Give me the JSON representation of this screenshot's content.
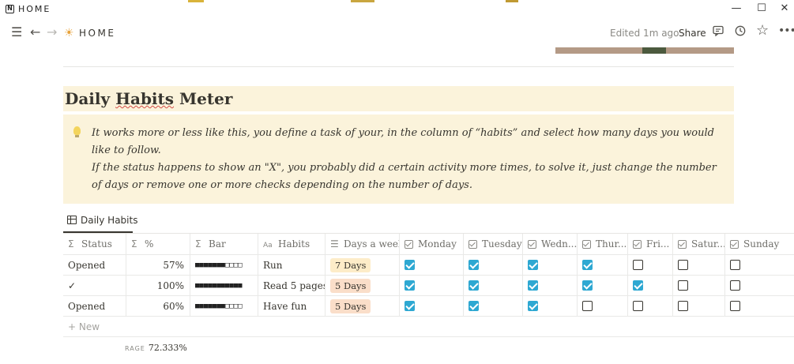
{
  "window": {
    "title": "HOME"
  },
  "toolbar": {
    "page_emoji": "☀",
    "page_title": "HOME",
    "edited": "Edited 1m ago",
    "share": "Share"
  },
  "heading": {
    "word1": "Daily",
    "word2": "Habits",
    "word3": "Meter"
  },
  "callout": {
    "p1": "It works more or less like this, you define a task of your, in the column of “habits” and select how many days you would like to follow.",
    "p2": "If the status happens to show an \"X\", you probably did a certain activity more times, to solve it, just change the number of days or remove one or more checks depending on the number of days."
  },
  "view": {
    "tab": "Daily Habits"
  },
  "columns": [
    "Status",
    "%",
    "Bar",
    "Habits",
    "Days a week",
    "Monday",
    "Tuesday",
    "Wedn...",
    "Thur...",
    "Fri...",
    "Satur...",
    "Sunday"
  ],
  "rows": [
    {
      "status": "Opened",
      "percent": "57%",
      "bar": "■■■■■■■□□□□",
      "habit": "Run",
      "days": "7 Days",
      "days_color": "#fdecc8",
      "checks": [
        true,
        true,
        true,
        true,
        false,
        false,
        false
      ]
    },
    {
      "status": "✓",
      "percent": "100%",
      "bar": "■■■■■■■■■■■",
      "habit": "Read 5 pages",
      "days": "5 Days",
      "days_color": "#fadec9",
      "checks": [
        true,
        true,
        true,
        true,
        true,
        false,
        false
      ]
    },
    {
      "status": "Opened",
      "percent": "60%",
      "bar": "■■■■■■■□□□□",
      "habit": "Have fun",
      "days": "5 Days",
      "days_color": "#fadec9",
      "checks": [
        true,
        true,
        true,
        false,
        false,
        false,
        false
      ]
    }
  ],
  "new_row": "+ New",
  "calculation": {
    "label": "RAGE",
    "value": "72.333%"
  }
}
